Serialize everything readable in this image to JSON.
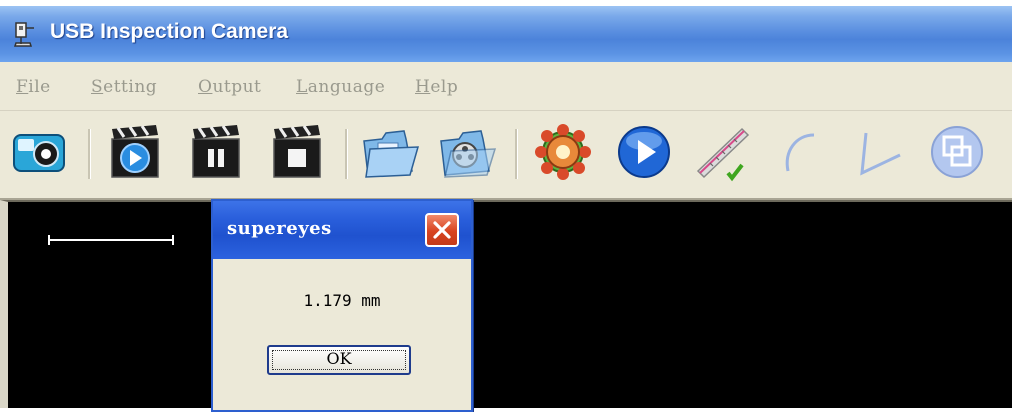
{
  "window": {
    "title": "USB Inspection Camera",
    "menu": [
      "File",
      "Setting",
      "Output",
      "Language",
      "Help"
    ]
  },
  "toolbar": {
    "buttons": [
      "camera-snapshot-icon",
      "record-play-icon",
      "record-pause-icon",
      "record-stop-icon",
      "open-photo-folder-icon",
      "open-video-folder-icon",
      "settings-gear-icon",
      "play-icon",
      "ruler-measure-icon",
      "arc-measure-icon",
      "angle-measure-icon",
      "overlay-window-icon"
    ]
  },
  "dialog": {
    "title": "supereyes",
    "message": "1.179 mm",
    "ok_label": "OK"
  },
  "colors": {
    "titlebar": "#4c83da",
    "dialog_title": "#2a5fdc",
    "viewport": "#000000",
    "close": "#d8431f"
  }
}
